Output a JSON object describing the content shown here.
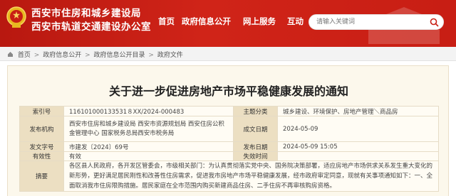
{
  "header": {
    "org_line1": "西安市住房和城乡建设局",
    "org_line2": "西安市轨道交通建设办公室",
    "emblem_icon": "national-emblem-icon",
    "colors": {
      "brand_red": "#c81e14",
      "text_on_brand": "#ffffff"
    }
  },
  "nav": {
    "items": [
      {
        "label": "首页"
      },
      {
        "label": "政府信息公开"
      },
      {
        "label": "网上服务"
      },
      {
        "label": "互动"
      }
    ]
  },
  "search": {
    "placeholder": "请输入关键词"
  },
  "breadcrumb": {
    "home_icon": "home-icon",
    "items": [
      "首页",
      "政府信息公开",
      "政府信息公开目录",
      "政府文件"
    ],
    "separator": ">"
  },
  "article": {
    "title": "关于进一步促进房地产市场平稳健康发展的通知",
    "meta": {
      "index_label": "索引号",
      "index_value": "116101000133531８XX/2024-000483",
      "topic_label": "主题分类",
      "topic_value": "城乡建设、环境保护、房地产管理＼商品房",
      "issuer_label": "发布机构",
      "issuer_value": "西安市住房和城乡建设局 西安市资源规划局 西安住房公积金管理中心 国家税务总局西安市税务局",
      "date_label": "成文日期",
      "date_value": "2024-05-09",
      "docno_label": "发文字号",
      "docno_value": "市建发〔2024〕69号",
      "pubdate_label": "发布日期",
      "pubdate_value": "2024-05-09 15:05",
      "validity_label": "有效性",
      "validity_value": "有效",
      "expire_label": "失效时间",
      "expire_value": "",
      "summary_label": "摘要",
      "summary_value": "各区县人民政府，各开发区管委会，市级相关部门：为认真贯彻落实党中央、国务院决策部署，适应房地产市场供求关系发生重大变化的新形势，更好满足居民刚性和改善性住房需求，促进我市房地产市场平稳健康发展，经市政府审定同意，现就有关事项通知如下：一、全面取消我市住房限购措施。居民家庭在全市范围内购买新建商品住房、二手住房不再审核购房资格。"
    }
  }
}
